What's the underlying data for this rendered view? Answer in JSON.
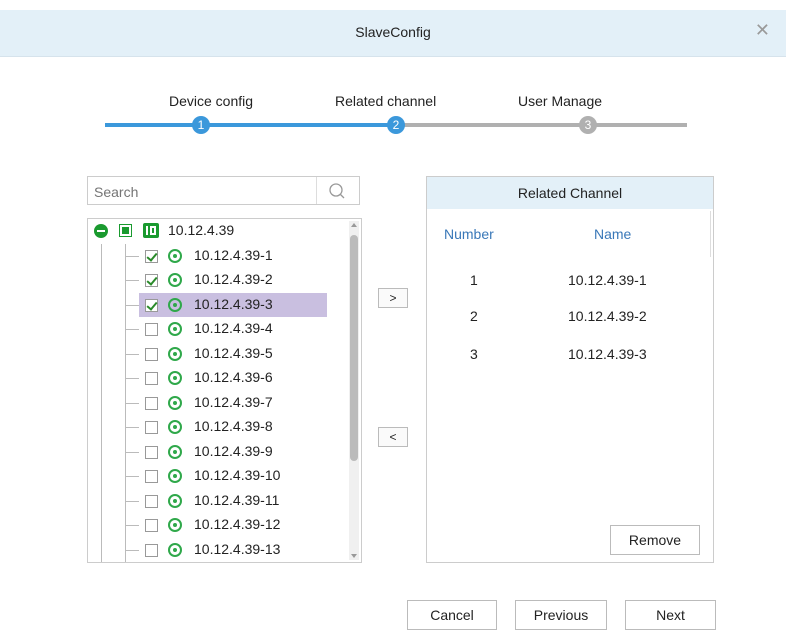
{
  "dialog": {
    "title": "SlaveConfig",
    "close_icon": "close-icon"
  },
  "steps": [
    {
      "label": "Device config",
      "number": "1",
      "status": "done"
    },
    {
      "label": "Related channel",
      "number": "2",
      "status": "active"
    },
    {
      "label": "User Manage",
      "number": "3",
      "status": "pending"
    }
  ],
  "colors": {
    "step_active": "#3b98db",
    "step_inactive": "#b0b0b0",
    "header_bg": "#e3f0f8",
    "selected_row_bg": "#c9bfe0",
    "channel_icon": "#2fa84a"
  },
  "search": {
    "placeholder": "Search",
    "value": "",
    "icon": "search-icon"
  },
  "tree": {
    "root": {
      "label": "10.12.4.39",
      "expanded": true,
      "checked": "partial"
    },
    "channels": [
      {
        "label": "10.12.4.39-1",
        "checked": true,
        "selected": false
      },
      {
        "label": "10.12.4.39-2",
        "checked": true,
        "selected": false
      },
      {
        "label": "10.12.4.39-3",
        "checked": true,
        "selected": true
      },
      {
        "label": "10.12.4.39-4",
        "checked": false,
        "selected": false
      },
      {
        "label": "10.12.4.39-5",
        "checked": false,
        "selected": false
      },
      {
        "label": "10.12.4.39-6",
        "checked": false,
        "selected": false
      },
      {
        "label": "10.12.4.39-7",
        "checked": false,
        "selected": false
      },
      {
        "label": "10.12.4.39-8",
        "checked": false,
        "selected": false
      },
      {
        "label": "10.12.4.39-9",
        "checked": false,
        "selected": false
      },
      {
        "label": "10.12.4.39-10",
        "checked": false,
        "selected": false
      },
      {
        "label": "10.12.4.39-11",
        "checked": false,
        "selected": false
      },
      {
        "label": "10.12.4.39-12",
        "checked": false,
        "selected": false
      },
      {
        "label": "10.12.4.39-13",
        "checked": false,
        "selected": false
      }
    ]
  },
  "move": {
    "add_label": ">",
    "remove_label": "<"
  },
  "related": {
    "title": "Related Channel",
    "columns": [
      "Number",
      "Name"
    ],
    "rows": [
      {
        "number": "1",
        "name": "10.12.4.39-1"
      },
      {
        "number": "2",
        "name": "10.12.4.39-2"
      },
      {
        "number": "3",
        "name": "10.12.4.39-3"
      }
    ],
    "remove_label": "Remove"
  },
  "footer": {
    "cancel_label": "Cancel",
    "previous_label": "Previous",
    "next_label": "Next"
  }
}
